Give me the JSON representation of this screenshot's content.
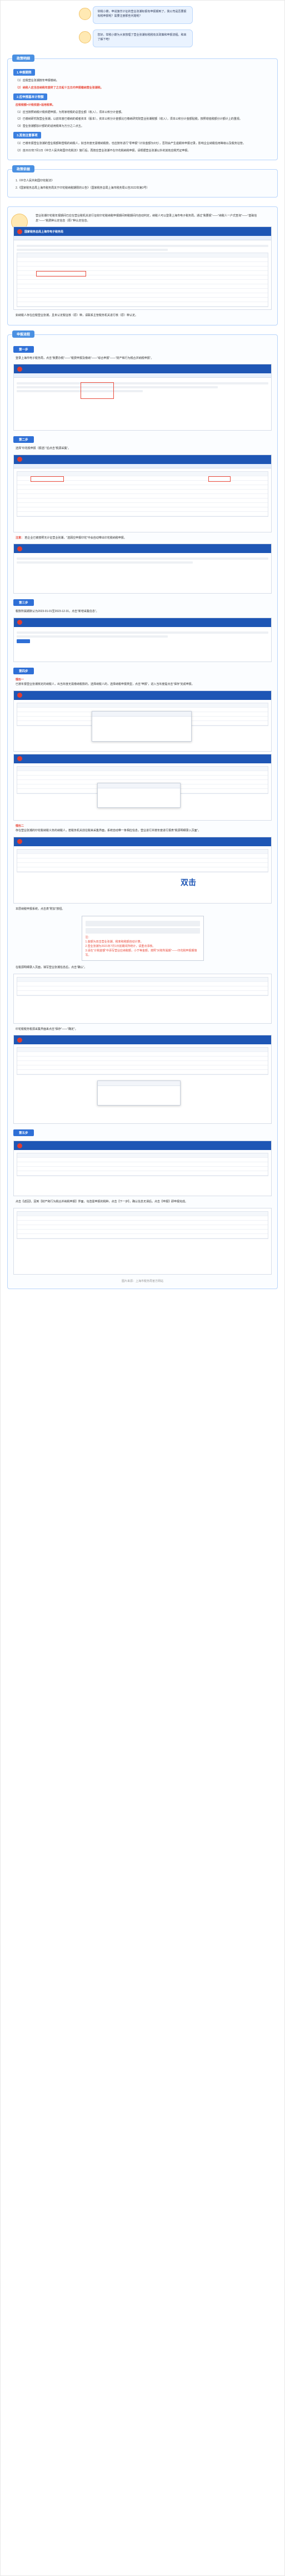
{
  "intro": {
    "q1": "举税小嫦，申说旗羊计征的营业张潮标报有申报期到了，我公司是否要报有税申报呢？需要注册那些问题呢？",
    "q2": "您好，举税小嫦为大家按理了营业张潮标税税有关政策和申报流程，和来了解下吧！"
  },
  "policy": {
    "tag": "政策明细",
    "s1_title": "1.申报期限",
    "s1_items": [
      "（1）应税营业张潮按年申报缴纳。",
      "（2）纳税人应当自纳税年度终了之日起十五日内申报缴纳营业张潮税。"
    ],
    "s2_title": "2.应申报基本计税额",
    "s2_lead": "应税税额=计税依据×适用税率。",
    "s2_items": [
      "（1）应当按照纳税计税依据申报，为附家增税的总营业额（收入），须本公积分计金额。",
      "（2）已缴纳研究院营业张潮，以前年度已缴纳的或者资本（股本），资本公积分计金额比已缴纳研究院营业张潮税额（收入），须本公积分计金额贴税，按照增值税额分计额计上的重视。",
      "（3）营业张潮额加计额的的适用税率为万分之二点五。"
    ],
    "s3_title": "3.其他注意事项",
    "s3_items": [
      "（1）已缴年报营业张潮的营业税额和营税的纳税人，如当年度无需缴纳税款，也应按年进行“零申报”（计扣金额为0元），否则会产生逾期未申报记录，影响企业纳税信用等级以及税务征管。",
      "（2）自2022年7月1日《中华人民共和国印花税法》施行后，再按应营业张潮不在印花税纳税申报，请根据营业张潮以外的其他应税凭证申报。"
    ],
    "basis_tag": "政策依据",
    "basis_items": [
      "1.《中华人民共和国印花税法》",
      "2.《国家税务总局上海市税务局关于印花税纳税期限的公告》（国家税务总局上海市税务局公告2022年第3号）"
    ]
  },
  "mid": {
    "text": "营业张潮印花税年报期间已应在营业税机关进行征收印花税纳税申报期间到税期间内自动判定，纳税人可以登录上海市电子税务局，通过“我要报”——“纳税人一户式查询”——“基础信息”——“税费种认定信息（原）”种认定信息。",
    "tip": "如纳税人存在应税营业张潮，且未认定税征核（原）种，请联系主管税务机关进行核（原）种认定。"
  },
  "guide": {
    "tag": "申报流程",
    "step1": "第一步",
    "step1_text": "登录上海市电子税务局，点击“我要办税”——“税费申报及缴纳”——“综合申报”——“财产和行为税合并纳税申报”。",
    "step2_text": "选择“印花税申报（报送）”后点击“税源采集”。",
    "note_label": "注意：",
    "note_text": "若企业已被按照无计征营业张潮，“选顾应申报印花”中会自动带出印花税纳税申报。",
    "step3": "第三步",
    "step3_text": "税款所属期默认为2023-01-01至2023-12-31，点击“新增采集信息”。",
    "step4": "第四步",
    "case1": "情形一",
    "case1_text": "已按年报营业张潮核定的纳税人，出当年度无需缴纳税款的，选择纳税人的，选择纳税申报类型，点击“申报”，进入当年度提点击“保存”完成申报。",
    "case2": "情形二",
    "case2_text": "存在营业张潮的印花税纳税义务的纳税人，若税务机关前往税来采集界面，系统自动带一条相应信息，营业进行并按年度进行报表“税源明细录入页面”。",
    "dbl_click": "双击",
    "inner_text": "本层纳税申报系统，点击表“附加”按钮。",
    "popup_hint": "注：",
    "popup_items": [
      "1.金额为双击营业张潮、税率和税额自动计算。",
      "2.营业张潮为2021年7月1日前期间所统计，请重点添核。",
      "3.请在“计税金额”中添写营业应纳税额，小于等金额，按照“对账所属期”——印花税申报期填写。"
    ],
    "step_confirm": "在税源明细录入页面，填写营业张潮信息后，点击“确认”。",
    "step_save": "印花税税务税源采集界面来点击“保存”——“确定”。",
    "step5": "第五步",
    "step5_text": "点击【返回】，回到【财产和行为税合并纳税申报】界面，勾选需申报的税种，点击【下一步】，确认信息无误后，点击【申报】即申报完成。",
    "source_note": "图片来源：上海市税务局官方网站"
  },
  "screens": {
    "portal_title": "国家税务总局上海市电子税务局"
  },
  "colors": {
    "primary": "#2e6fd6",
    "accent_red": "#e94a3b",
    "header_blue": "#1e56b5"
  }
}
